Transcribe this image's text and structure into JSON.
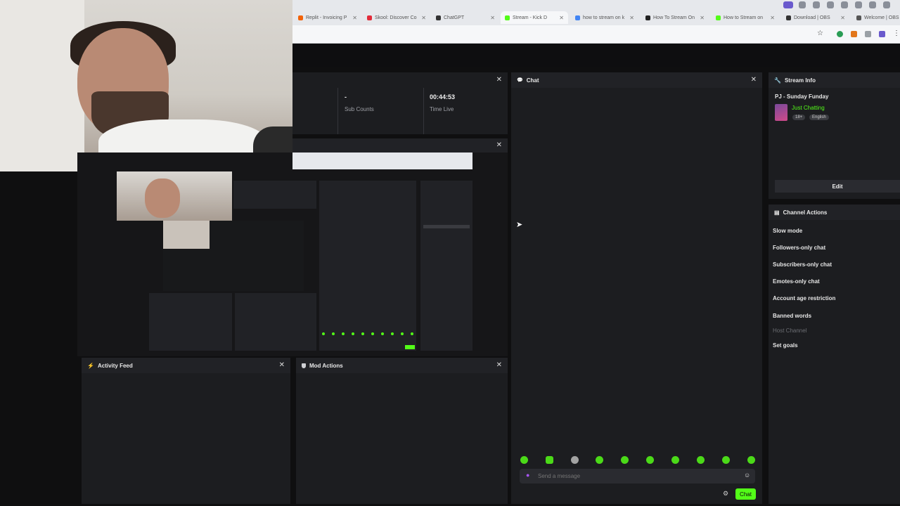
{
  "browser": {
    "tabs": [
      {
        "label": "Replit - Invoicing P",
        "color": "#f26207"
      },
      {
        "label": "Skool: Discover Co",
        "color": "#e22b3a"
      },
      {
        "label": "ChatGPT",
        "color": "#333333"
      },
      {
        "label": "Stream - Kick D",
        "color": "#53fc18"
      },
      {
        "label": "how to stream on k",
        "color": "#4285f4"
      },
      {
        "label": "How To Stream On",
        "color": "#222222"
      },
      {
        "label": "How to Stream on",
        "color": "#53fc18"
      },
      {
        "label": "Download | OBS",
        "color": "#333333"
      },
      {
        "label": "Welcome | OBS",
        "color": "#555555"
      }
    ]
  },
  "stats": {
    "sub_counts_value": "-",
    "sub_counts_label": "Sub Counts",
    "time_live_value": "00:44:53",
    "time_live_label": "Time Live"
  },
  "chat": {
    "title": "Chat",
    "placeholder": "Send a message",
    "send_label": "Chat"
  },
  "stream_info": {
    "title": "Stream Info",
    "stream_title": "PJ - Sunday Funday",
    "category": "Just Chatting",
    "badges": [
      "18+",
      "English"
    ],
    "edit_label": "Edit"
  },
  "channel_actions": {
    "title": "Channel Actions",
    "items": [
      {
        "label": "Slow mode",
        "enabled": true
      },
      {
        "label": "Followers-only chat",
        "enabled": true
      },
      {
        "label": "Subscribers-only chat",
        "enabled": true
      },
      {
        "label": "Emotes-only chat",
        "enabled": true
      },
      {
        "label": "Account age restriction",
        "enabled": true
      },
      {
        "label": "Banned words",
        "enabled": true
      },
      {
        "label": "Host Channel",
        "enabled": false
      },
      {
        "label": "Set goals",
        "enabled": true
      }
    ]
  },
  "activity_feed": {
    "title": "Activity Feed"
  },
  "mod_actions": {
    "title": "Mod Actions"
  },
  "colors": {
    "accent": "#53fc18",
    "panel": "#1c1d20",
    "background": "#0f0f10"
  }
}
